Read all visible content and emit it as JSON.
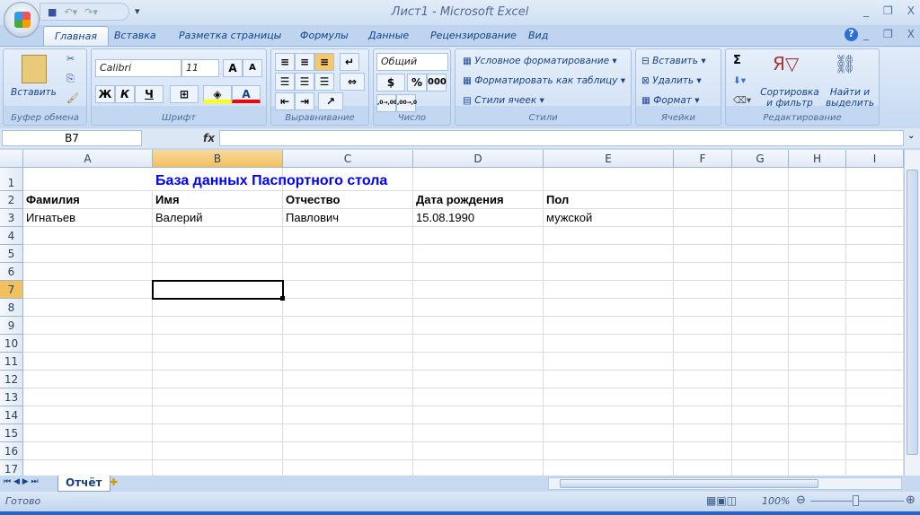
{
  "window": {
    "title": "Лист1  -  Microsoft Excel",
    "minimize": "_",
    "restore": "❐",
    "close": "X"
  },
  "tabs": [
    "Главная",
    "Вставка",
    "Разметка страницы",
    "Формулы",
    "Данные",
    "Рецензирование",
    "Вид"
  ],
  "ribbon": {
    "clipboard": {
      "paste": "Вставить",
      "label": "Буфер обмена"
    },
    "font": {
      "name": "Calibri",
      "size": "11",
      "bold": "Ж",
      "italic": "К",
      "underline": "Ч",
      "grow": "A",
      "shrink": "A",
      "color_letter": "A",
      "label": "Шрифт"
    },
    "alignment": {
      "label": "Выравнивание"
    },
    "number": {
      "format": "Общий",
      "percent": "%",
      "thousands": "000",
      "inc": ",0→,00",
      "dec": ",00→,0",
      "label": "Число"
    },
    "styles": {
      "conditional": "Условное форматирование",
      "as_table": "Форматировать как таблицу",
      "cell_styles": "Стили ячеек",
      "label": "Стили"
    },
    "cells": {
      "insert": "Вставить",
      "delete": "Удалить",
      "format": "Формат",
      "label": "Ячейки"
    },
    "editing": {
      "sum": "Σ",
      "sort": "Сортировка и фильтр",
      "find": "Найти и выделить",
      "label": "Редактирование"
    },
    "colors": {
      "fill": "#ffff00",
      "font": "#ff0000"
    }
  },
  "formula_bar": {
    "name_box": "B7",
    "fx": "fx",
    "value": ""
  },
  "columns": [
    "A",
    "B",
    "C",
    "D",
    "E",
    "F",
    "G",
    "H",
    "I"
  ],
  "rows": [
    "1",
    "2",
    "3",
    "4",
    "5",
    "6",
    "7",
    "8",
    "9",
    "10",
    "11",
    "12",
    "13",
    "14",
    "15",
    "16",
    "17"
  ],
  "cells": {
    "B1": "База данных Паспортного стола",
    "A2": "Фамилия",
    "B2": "Имя",
    "C2": "Отчество",
    "D2": "Дата рождения",
    "E2": "Пол",
    "A3": "Игнатьев",
    "B3": "Валерий",
    "C3": "Павлович",
    "D3": "15.08.1990",
    "E3": "мужской"
  },
  "selected_cell": "B7",
  "title_color": "#0000ff",
  "sheets": [
    "Отчёт"
  ],
  "status": {
    "ready": "Готово",
    "zoom": "100%"
  }
}
